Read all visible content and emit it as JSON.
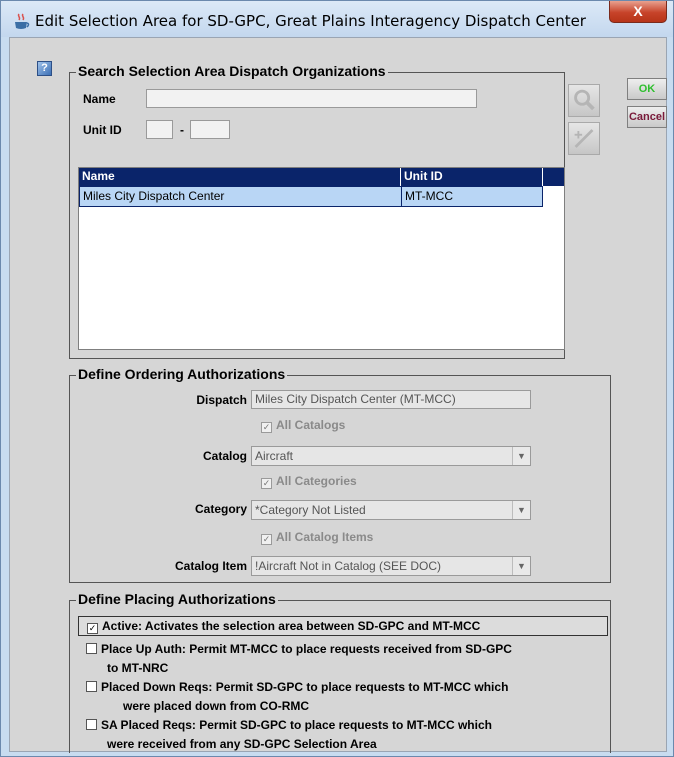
{
  "window": {
    "title": "Edit Selection Area for SD-GPC, Great Plains Interagency Dispatch Center",
    "close_label": "X"
  },
  "help": {
    "label": "?"
  },
  "search": {
    "legend": "Search Selection Area Dispatch Organizations",
    "name_label": "Name",
    "name_value": "",
    "unit_id_label": "Unit ID",
    "unit_id_left": "",
    "unit_id_sep": "-",
    "unit_id_right": "",
    "table": {
      "columns": [
        "Name",
        "Unit ID"
      ],
      "rows": [
        {
          "name": "Miles City Dispatch Center",
          "unit_id": "MT-MCC"
        }
      ]
    }
  },
  "actions": {
    "ok": "OK",
    "cancel": "Cancel"
  },
  "ordering": {
    "legend": "Define Ordering Authorizations",
    "dispatch_label": "Dispatch",
    "dispatch_value": "Miles City Dispatch Center (MT-MCC)",
    "all_catalogs": "All Catalogs",
    "catalog_label": "Catalog",
    "catalog_value": "Aircraft",
    "all_categories": "All Categories",
    "category_label": "Category",
    "category_value": "*Category Not Listed",
    "all_catalog_items": "All Catalog Items",
    "catalog_item_label": "Catalog Item",
    "catalog_item_value": "!Aircraft Not in Catalog (SEE DOC)"
  },
  "placing": {
    "legend": "Define Placing Authorizations",
    "items": [
      {
        "line1": "Active: Activates the selection area between SD-GPC and MT-MCC",
        "line2": "",
        "checked": true
      },
      {
        "line1": "Place Up Auth:  Permit MT-MCC to place requests received from SD-GPC",
        "line2": "to MT-NRC",
        "checked": false
      },
      {
        "line1": "Placed Down Reqs: Permit SD-GPC to place requests to MT-MCC which",
        "line2": "were placed down from CO-RMC",
        "checked": false
      },
      {
        "line1": "SA Placed Reqs: Permit SD-GPC to place requests to MT-MCC which",
        "line2": "were received from any SD-GPC Selection Area",
        "checked": false
      }
    ]
  },
  "colors": {
    "table_header": "#0a246a",
    "row_selected": "#b9d6f5",
    "ok_text": "#2fbf2f",
    "cancel_text": "#7a1a3a",
    "close_button": "#c7432a"
  },
  "icons": {
    "app": "java-cup-icon",
    "help": "help-icon",
    "search": "magnifier-icon",
    "clear": "clear-icon",
    "checkmark": "checkmark-icon",
    "dropdown": "chevron-down-icon"
  }
}
